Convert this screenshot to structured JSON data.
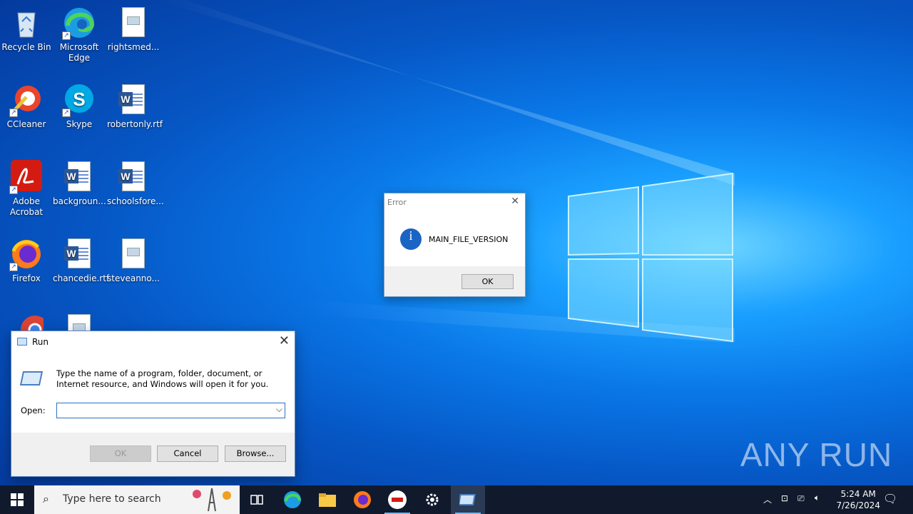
{
  "desktop": {
    "icons": [
      {
        "label": "Recycle Bin",
        "icon": "recycle-bin-icon"
      },
      {
        "label": "Microsoft Edge",
        "icon": "edge-icon"
      },
      {
        "label": "rightsmed...",
        "icon": "image-file-icon"
      },
      {
        "label": "CCleaner",
        "icon": "ccleaner-icon"
      },
      {
        "label": "Skype",
        "icon": "skype-icon"
      },
      {
        "label": "robertonly.rtf",
        "icon": "word-file-icon"
      },
      {
        "label": "Adobe Acrobat",
        "icon": "acrobat-icon"
      },
      {
        "label": "backgroun...",
        "icon": "word-file-icon"
      },
      {
        "label": "schoolsfore...",
        "icon": "word-file-icon"
      },
      {
        "label": "Firefox",
        "icon": "firefox-icon"
      },
      {
        "label": "chancedie.rtf",
        "icon": "word-file-icon"
      },
      {
        "label": "steveanno...",
        "icon": "image-file-icon"
      }
    ]
  },
  "error_dialog": {
    "title": "Error",
    "message": "MAIN_FILE_VERSION",
    "ok_label": "OK",
    "info_glyph": "i"
  },
  "run_dialog": {
    "title": "Run",
    "description": "Type the name of a program, folder, document, or Internet resource, and Windows will open it for you.",
    "open_label": "Open:",
    "open_value": "",
    "ok_label": "OK",
    "cancel_label": "Cancel",
    "browse_label": "Browse..."
  },
  "taskbar": {
    "search_placeholder": "Type here to search",
    "time": "5:24 AM",
    "date": "7/26/2024"
  },
  "watermark": {
    "text": "ANY RUN"
  },
  "colors": {
    "accent": "#0078d7",
    "taskbar": "#101a2c"
  }
}
